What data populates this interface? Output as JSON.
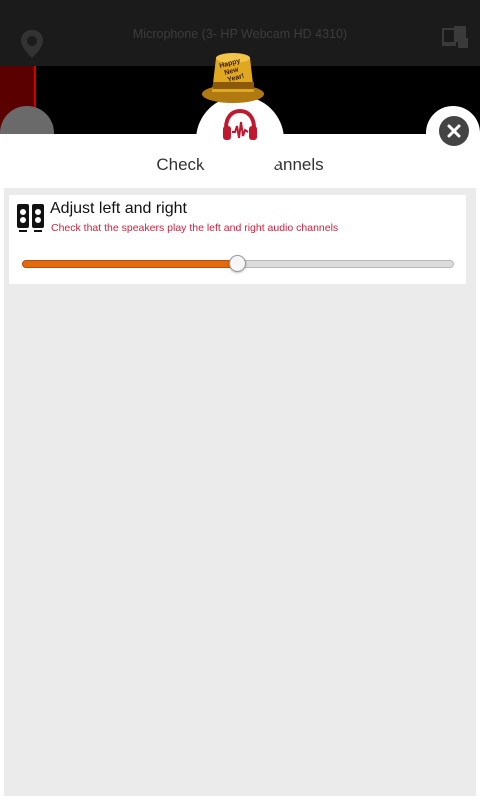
{
  "topbar": {
    "device_title": "Microphone (3- HP Webcam HD 4310)",
    "left_icon": "location-pin-icon",
    "right_icon": "devices-icon"
  },
  "modal": {
    "title": "Check audio channels",
    "hat_text": [
      "Happy",
      "New",
      "Year!"
    ],
    "center_icon": "headphones-icon",
    "close_icon": "close-icon"
  },
  "card": {
    "icon": "speakers-icon",
    "title": "Adjust left and right",
    "subtitle": "Check that the speakers play the left and right audio channels"
  },
  "balance_slider": {
    "value": 0.5
  },
  "colors": {
    "accent": "#e46a10",
    "subtitle": "#d0203f",
    "headphones": "#c0182e",
    "close_button": "#444444",
    "panel_bg": "#ebebeb"
  }
}
